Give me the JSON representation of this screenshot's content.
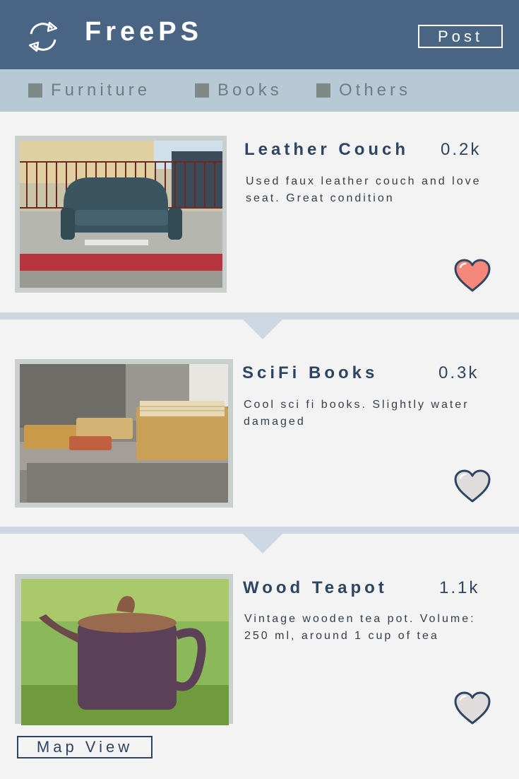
{
  "header": {
    "refresh_icon": "refresh-icon",
    "app_title": "FreePS",
    "post_label": "Post",
    "background_color": "#4a6483"
  },
  "filters": [
    {
      "label": "Furniture"
    },
    {
      "label": "Books"
    },
    {
      "label": "Others"
    }
  ],
  "listings": [
    {
      "title": "Leather Couch",
      "count": "0.2k",
      "description": "Used faux leather couch and love seat. Great condition",
      "image": "photo of a dark green leather couch on a sidewalk",
      "liked": true
    },
    {
      "title": "SciFi Books",
      "count": "0.3k",
      "description": "Cool sci fi books. Slightly water damaged",
      "image": "photo of old worn books on stone steps",
      "liked": false
    },
    {
      "title": "Wood Teapot",
      "count": "1.1k",
      "description": "Vintage wooden tea pot. Volume: 250 ml, around 1 cup of tea",
      "image": "photo of a carved wooden teapot on grass",
      "liked": false
    }
  ],
  "map_view_label": "Map View",
  "colors": {
    "accent_dark": "#2e4561",
    "liked_heart": "#f4877a",
    "unliked_heart": "#e0dcdc",
    "filter_bar": "#b7c9d5"
  }
}
